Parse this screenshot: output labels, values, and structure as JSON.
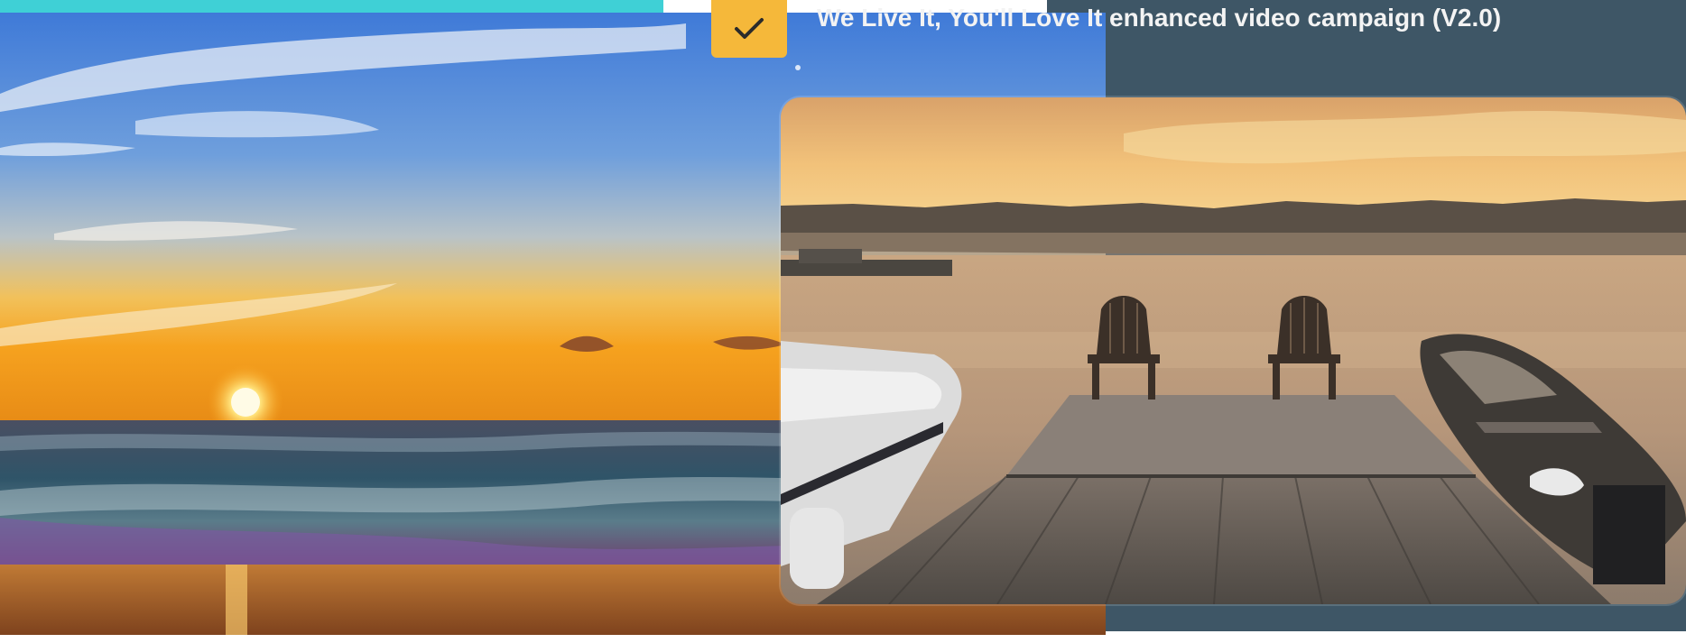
{
  "header": {
    "title": "We Live It, You'll Love It enhanced video campaign (V2.0)"
  },
  "badge": {
    "icon": "checkmark-icon"
  },
  "colors": {
    "teal_bar": "#3fd0d6",
    "slate_panel": "#3e5666",
    "badge": "#f5b83a"
  },
  "images": {
    "left": "sunset-beach-photo",
    "right": "lake-dock-chairs-photo"
  }
}
